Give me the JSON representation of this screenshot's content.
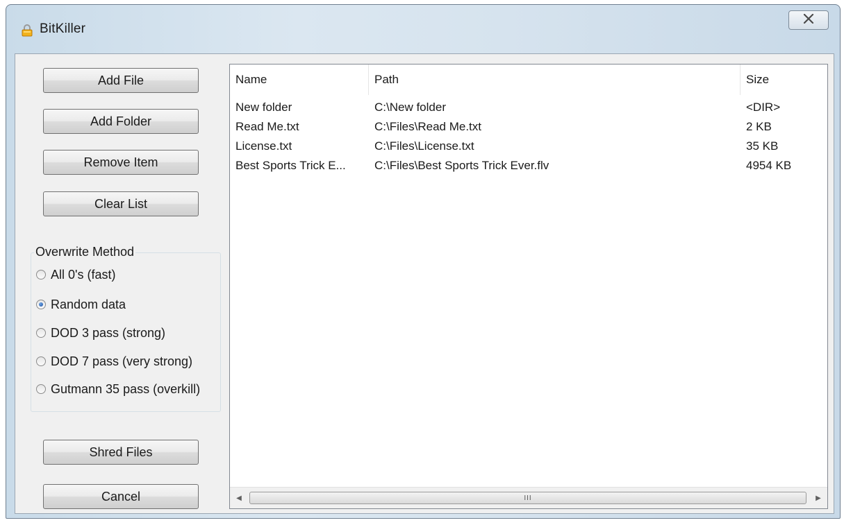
{
  "window": {
    "title": "BitKiller",
    "app_icon": "padlock-icon",
    "close_icon": "close-icon"
  },
  "buttons": {
    "add_file": "Add File",
    "add_folder": "Add Folder",
    "remove_item": "Remove Item",
    "clear_list": "Clear List",
    "shred_files": "Shred Files",
    "cancel": "Cancel"
  },
  "overwrite": {
    "label": "Overwrite Method",
    "options": [
      {
        "label": "All 0's (fast)",
        "checked": false
      },
      {
        "label": "Random data",
        "checked": true
      },
      {
        "label": "DOD 3 pass (strong)",
        "checked": false
      },
      {
        "label": "DOD 7 pass (very strong)",
        "checked": false
      },
      {
        "label": "Gutmann 35 pass (overkill)",
        "checked": false
      }
    ]
  },
  "list": {
    "columns": [
      "Name",
      "Path",
      "Size"
    ],
    "rows": [
      {
        "name": "New folder",
        "path": "C:\\New folder",
        "size": "<DIR>"
      },
      {
        "name": "Read Me.txt",
        "path": "C:\\Files\\Read Me.txt",
        "size": "2 KB"
      },
      {
        "name": "License.txt",
        "path": "C:\\Files\\License.txt",
        "size": "35 KB"
      },
      {
        "name": "Best Sports Trick E...",
        "path": "C:\\Files\\Best Sports Trick Ever.flv",
        "size": "4954 KB"
      }
    ],
    "scroll_grip": "III"
  },
  "colors": {
    "titlebar": "#d6e3ee",
    "client_bg": "#f0f0f0",
    "radio_checked": "#1c4f9e"
  }
}
